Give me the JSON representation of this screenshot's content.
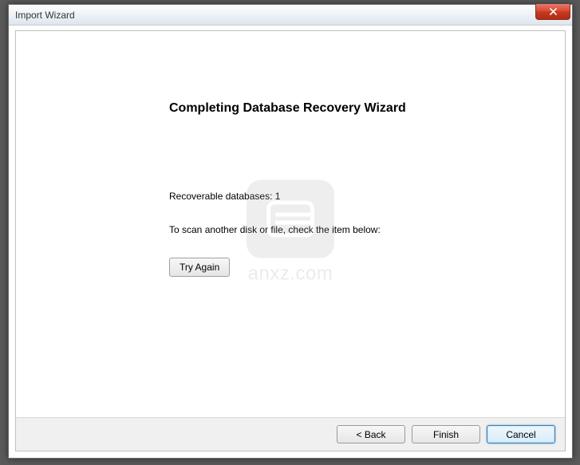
{
  "window": {
    "title": "Import Wizard"
  },
  "content": {
    "heading": "Completing Database Recovery Wizard",
    "recoverable_line": "Recoverable databases: 1",
    "rescan_line": "To scan another disk or file, check the item below:",
    "try_again_label": "Try Again"
  },
  "footer": {
    "back_label": "< Back",
    "finish_label": "Finish",
    "cancel_label": "Cancel"
  },
  "watermark": {
    "text": "anxz.com"
  }
}
